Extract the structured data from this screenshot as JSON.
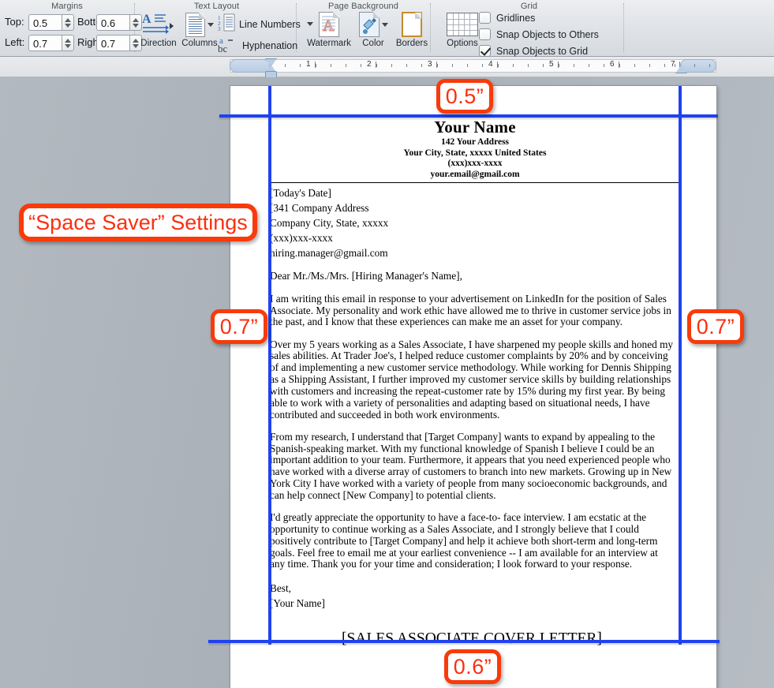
{
  "ribbon": {
    "groups": [
      {
        "name": "Margins",
        "title": "Margins"
      },
      {
        "name": "Text Layout",
        "title": "Text Layout"
      },
      {
        "name": "Page Background",
        "title": "Page Background"
      },
      {
        "name": "Grid",
        "title": "Grid"
      }
    ],
    "margins": {
      "top_label": "Top:",
      "top_value": "0.5",
      "bottom_label": "Bottom:",
      "bottom_value": "0.6",
      "left_label": "Left:",
      "left_value": "0.7",
      "right_label": "Right:",
      "right_value": "0.7"
    },
    "text_layout": {
      "direction_label": "Direction",
      "columns_label": "Columns",
      "line_numbers_label": "Line Numbers",
      "hyphenation_label": "Hyphenation"
    },
    "page_background": {
      "watermark_label": "Watermark",
      "color_label": "Color",
      "borders_label": "Borders"
    },
    "grid": {
      "options_label": "Options",
      "gridlines_label": "Gridlines",
      "gridlines_checked": false,
      "snap_others_label": "Snap Objects to Others",
      "snap_others_checked": false,
      "snap_grid_label": "Snap Objects to Grid",
      "snap_grid_checked": true
    }
  },
  "ruler": {
    "numbers": [
      "1",
      "2",
      "3",
      "4",
      "5",
      "6",
      "7"
    ]
  },
  "document": {
    "header": {
      "name": "Your Name",
      "address": "142 Your Address",
      "city_line": "Your City, State, xxxxx United States",
      "phone": "(xxx)xxx-xxxx",
      "email": "your.email@gmail.com"
    },
    "recipient": {
      "date": "[Today's Date]",
      "street": "[341 Company Address",
      "city_line": "Company City, State, xxxxx",
      "phone": "(xxx)xxx-xxxx",
      "email": "hiring.manager@gmail.com"
    },
    "salutation": "Dear Mr./Ms./Mrs. [Hiring Manager's Name],",
    "paragraph1": "I am writing this email in response to your advertisement on LinkedIn for the position of Sales Associate. My personality and work ethic have allowed me to thrive in customer service jobs in the past, and I know that these experiences can make me an asset for your company.",
    "paragraph2": "Over my 5 years working as a Sales Associate, I have sharpened my people skills and honed my sales abilities. At Trader Joe's, I helped reduce customer complaints by 20% and by conceiving of and implementing a new customer service methodology. While working for Dennis Shipping as a Shipping Assistant, I further improved my customer service skills by building relationships with customers and increasing the repeat-customer rate by 15% during my first year. By being able to work with a variety of personalities and adapting based on situational needs, I have contributed and succeeded in both work environments.",
    "paragraph3": "From my research, I understand that [Target Company] wants to expand by appealing to the Spanish-speaking market. With my functional knowledge of Spanish I believe I could be an important addition to your team. Furthermore, it appears that you need experienced people who have worked with a diverse array of customers to branch into new markets. Growing up in New York City I have worked with a variety of people from many socioeconomic backgrounds, and can help connect [New Company] to potential clients.",
    "paragraph4": "I'd greatly appreciate the opportunity to have a face-to- face interview. I am ecstatic at the opportunity to continue working as a Sales Associate, and I strongly believe that I could positively contribute to [Target Company] and help it achieve both short-term and long-term goals. Feel free to email me at your earliest convenience -- I am available for an interview at any time. Thank you for your time and consideration; I look forward to your response.",
    "closing": "Best,",
    "signature": "[Your Name]",
    "footer_title": "[SALES ASSOCIATE COVER LETTER]"
  },
  "annotations": {
    "settings_label": "“Space Saver” Settings",
    "top_margin": "0.5”",
    "left_margin": "0.7”",
    "right_margin": "0.7”",
    "bottom_margin": "0.6”",
    "accent_color": "#f93a0a",
    "text_color": "#fb2f10",
    "guide_color": "#1f42ef"
  }
}
